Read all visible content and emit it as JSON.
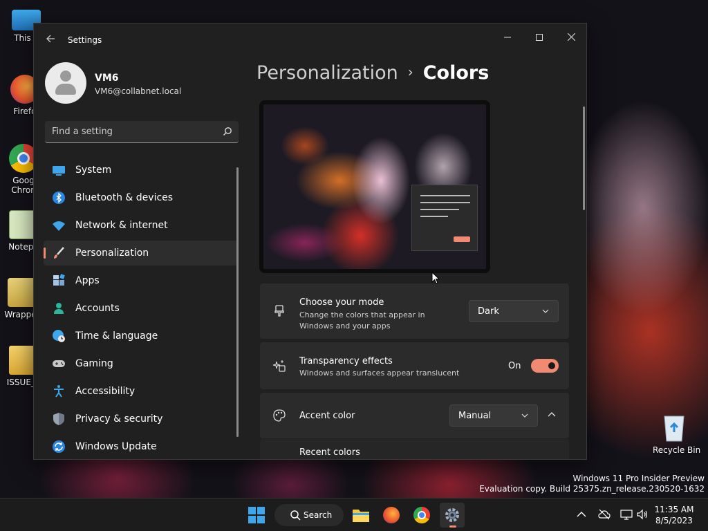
{
  "desktop": {
    "icons": [
      {
        "label": "This P"
      },
      {
        "label": "Firefo"
      },
      {
        "label": "Goog Chron"
      },
      {
        "label": "Notepa"
      },
      {
        "label": "Wrapper"
      },
      {
        "label": "ISSUE_T"
      }
    ],
    "recycle_bin": "Recycle Bin",
    "watermark_line1": "Windows 11 Pro Insider Preview",
    "watermark_line2": "Evaluation copy. Build 25375.zn_release.230520-1632"
  },
  "window": {
    "title": "Settings",
    "user": {
      "name": "VM6",
      "email": "VM6@collabnet.local"
    },
    "search": {
      "placeholder": "Find a setting"
    },
    "nav": [
      {
        "label": "System",
        "icon": "system-icon"
      },
      {
        "label": "Bluetooth & devices",
        "icon": "bluetooth-icon"
      },
      {
        "label": "Network & internet",
        "icon": "wifi-icon"
      },
      {
        "label": "Personalization",
        "icon": "brush-icon",
        "active": true
      },
      {
        "label": "Apps",
        "icon": "apps-icon"
      },
      {
        "label": "Accounts",
        "icon": "accounts-icon"
      },
      {
        "label": "Time & language",
        "icon": "globe-clock-icon"
      },
      {
        "label": "Gaming",
        "icon": "gamepad-icon"
      },
      {
        "label": "Accessibility",
        "icon": "accessibility-icon"
      },
      {
        "label": "Privacy & security",
        "icon": "shield-icon"
      },
      {
        "label": "Windows Update",
        "icon": "update-icon"
      }
    ],
    "breadcrumb": {
      "parent": "Personalization",
      "separator": "›",
      "current": "Colors"
    },
    "settings": {
      "mode": {
        "title": "Choose your mode",
        "desc": "Change the colors that appear in Windows and your apps",
        "value": "Dark"
      },
      "transparency": {
        "title": "Transparency effects",
        "desc": "Windows and surfaces appear translucent",
        "state": "On"
      },
      "accent": {
        "title": "Accent color",
        "value": "Manual"
      },
      "recent": {
        "title": "Recent colors"
      }
    }
  },
  "taskbar": {
    "search_label": "Search",
    "time": "11:35 AM",
    "date": "8/5/2023"
  },
  "colors": {
    "accent": "#f08a72",
    "window_bg": "#202020",
    "card_bg": "#2b2b2b"
  }
}
